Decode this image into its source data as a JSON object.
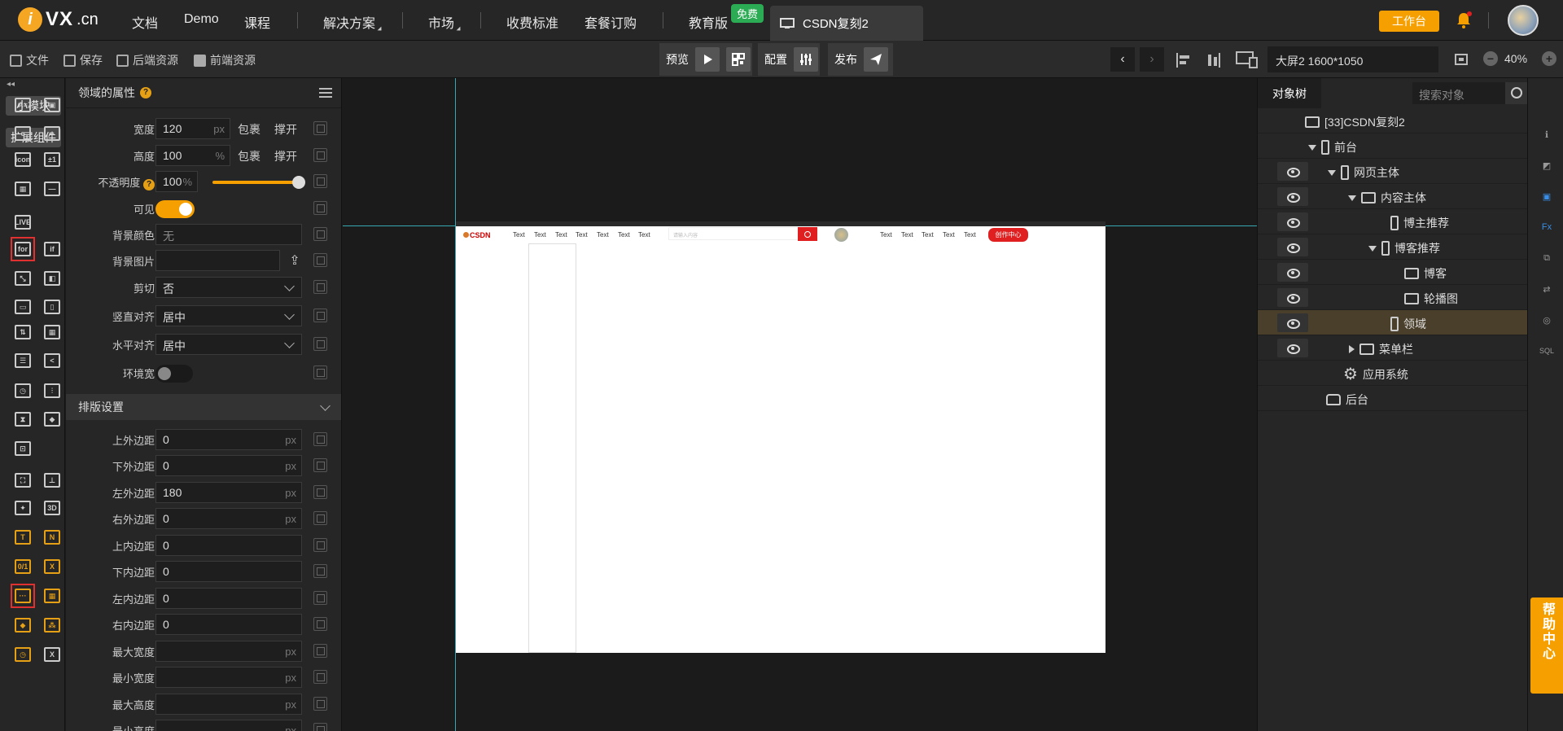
{
  "topbar": {
    "logo": "VX",
    "logo_suffix": ".cn",
    "nav": [
      "文档",
      "Demo",
      "课程",
      "解决方案",
      "市场",
      "收费标准",
      "套餐订购",
      "教育版"
    ],
    "free_badge": "免费",
    "active_tab": "CSDN复刻2",
    "workbench": "工作台"
  },
  "toolbar": {
    "file": "文件",
    "save": "保存",
    "backend": "后端资源",
    "frontend": "前端资源",
    "preview": "预览",
    "config": "配置",
    "publish": "发布",
    "screen": "大屏2 1600*1050",
    "zoom": "40%"
  },
  "iconbar": {
    "small_module": "小模块",
    "ext_components": "扩展组件",
    "icons": [
      {
        "name": "text-block-icon",
        "glyph": "A≡"
      },
      {
        "name": "image-text-icon",
        "glyph": "▣"
      },
      {
        "name": "browser-icon",
        "glyph": "e"
      },
      {
        "name": "map-pin-icon",
        "glyph": "⌖"
      },
      {
        "name": "icon-font-icon",
        "glyph": "icon"
      },
      {
        "name": "plus-minus-icon",
        "glyph": "±1"
      },
      {
        "name": "qrcode-icon",
        "glyph": "▦"
      },
      {
        "name": "divider-icon",
        "glyph": "—"
      },
      {
        "name": "live-icon",
        "glyph": "LIVE"
      },
      {
        "name": "for-loop-icon",
        "glyph": "for"
      },
      {
        "name": "if-condition-icon",
        "glyph": "if"
      },
      {
        "name": "shrink-icon",
        "glyph": "⤡"
      },
      {
        "name": "overlay-icon",
        "glyph": "◧"
      },
      {
        "name": "row-container-icon",
        "glyph": "▭"
      },
      {
        "name": "column-container-icon",
        "glyph": "▯"
      },
      {
        "name": "sort-icon",
        "glyph": "⇅"
      },
      {
        "name": "table-icon",
        "glyph": "▦"
      },
      {
        "name": "tree-list-icon",
        "glyph": "☰"
      },
      {
        "name": "share-icon",
        "glyph": "<"
      },
      {
        "name": "timer-icon",
        "glyph": "◷"
      },
      {
        "name": "sliders-icon",
        "glyph": "⫶"
      },
      {
        "name": "hourglass-icon",
        "glyph": "⧗"
      },
      {
        "name": "code-diamond-icon",
        "glyph": "◆"
      },
      {
        "name": "zoom-frame-icon",
        "glyph": "⊡"
      },
      {
        "name": "presentation-icon",
        "glyph": "⛶"
      },
      {
        "name": "hierarchy-icon",
        "glyph": "⊥"
      },
      {
        "name": "orbit-icon",
        "glyph": "✦"
      },
      {
        "name": "3d-icon",
        "glyph": "3D"
      },
      {
        "name": "text-var-icon",
        "glyph": "T"
      },
      {
        "name": "number-var-icon",
        "glyph": "N"
      },
      {
        "name": "fraction-var-icon",
        "glyph": "0/1"
      },
      {
        "name": "x-var-icon",
        "glyph": "X"
      },
      {
        "name": "dots-var-icon",
        "glyph": "···"
      },
      {
        "name": "grid-var-icon",
        "glyph": "▦"
      },
      {
        "name": "cube-icon",
        "glyph": "◆"
      },
      {
        "name": "cubes-icon",
        "glyph": "⁂"
      },
      {
        "name": "clock-var-icon",
        "glyph": "◷"
      },
      {
        "name": "excel-icon",
        "glyph": "X"
      }
    ]
  },
  "props": {
    "title": "领域的属性",
    "width_label": "宽度",
    "width_value": "120",
    "width_unit": "px",
    "height_label": "高度",
    "height_value": "100",
    "height_unit": "%",
    "wrap": "包裹",
    "stretch": "撑开",
    "opacity_label": "不透明度",
    "opacity_value": "100",
    "opacity_unit": "%",
    "opacity_level": 1.0,
    "visible_label": "可见",
    "visible": true,
    "bgcolor_label": "背景颜色",
    "bgcolor_value": "无",
    "bgimage_label": "背景图片",
    "clip_label": "剪切",
    "clip_value": "否",
    "valign_label": "竖直对齐",
    "valign_value": "居中",
    "halign_label": "水平对齐",
    "halign_value": "居中",
    "envwidth_label": "环境宽",
    "envwidth": false,
    "layout_section": "排版设置",
    "margin_top_label": "上外边距",
    "margin_top": "0",
    "margin_bottom_label": "下外边距",
    "margin_bottom": "0",
    "margin_left_label": "左外边距",
    "margin_left": "180",
    "margin_right_label": "右外边距",
    "margin_right": "0",
    "padding_top_label": "上内边距",
    "padding_top": "0",
    "padding_bottom_label": "下内边距",
    "padding_bottom": "0",
    "padding_left_label": "左内边距",
    "padding_left": "0",
    "padding_right_label": "右内边距",
    "padding_right": "0",
    "max_width_label": "最大宽度",
    "min_width_label": "最小宽度",
    "max_height_label": "最大高度",
    "min_height_label": "最小高度",
    "px": "px"
  },
  "preview_page": {
    "logo": "CSDN",
    "nav_texts_left": [
      "Text",
      "Text",
      "Text",
      "Text",
      "Text",
      "Text",
      "Text"
    ],
    "search_placeholder": "请输入内容",
    "nav_texts_right": [
      "Text",
      "Text",
      "Text",
      "Text",
      "Text"
    ],
    "create_center": "创作中心"
  },
  "tree": {
    "tab": "对象树",
    "search_placeholder": "搜索对象",
    "nodes": {
      "root": "[33]CSDN复刻2",
      "front": "前台",
      "page_body": "网页主体",
      "content_body": "内容主体",
      "blogger_rec": "博主推荐",
      "blog_rec": "博客推荐",
      "blog": "博客",
      "carousel": "轮播图",
      "domain": "领域",
      "menubar": "菜单栏",
      "app_system": "应用系统",
      "backend": "后台"
    }
  },
  "help": "帮助中心",
  "colors": {
    "accent": "#f5a000",
    "selected_row": "#4a3f2a",
    "guide": "#38a8b0",
    "csdn_red": "#e02020"
  }
}
